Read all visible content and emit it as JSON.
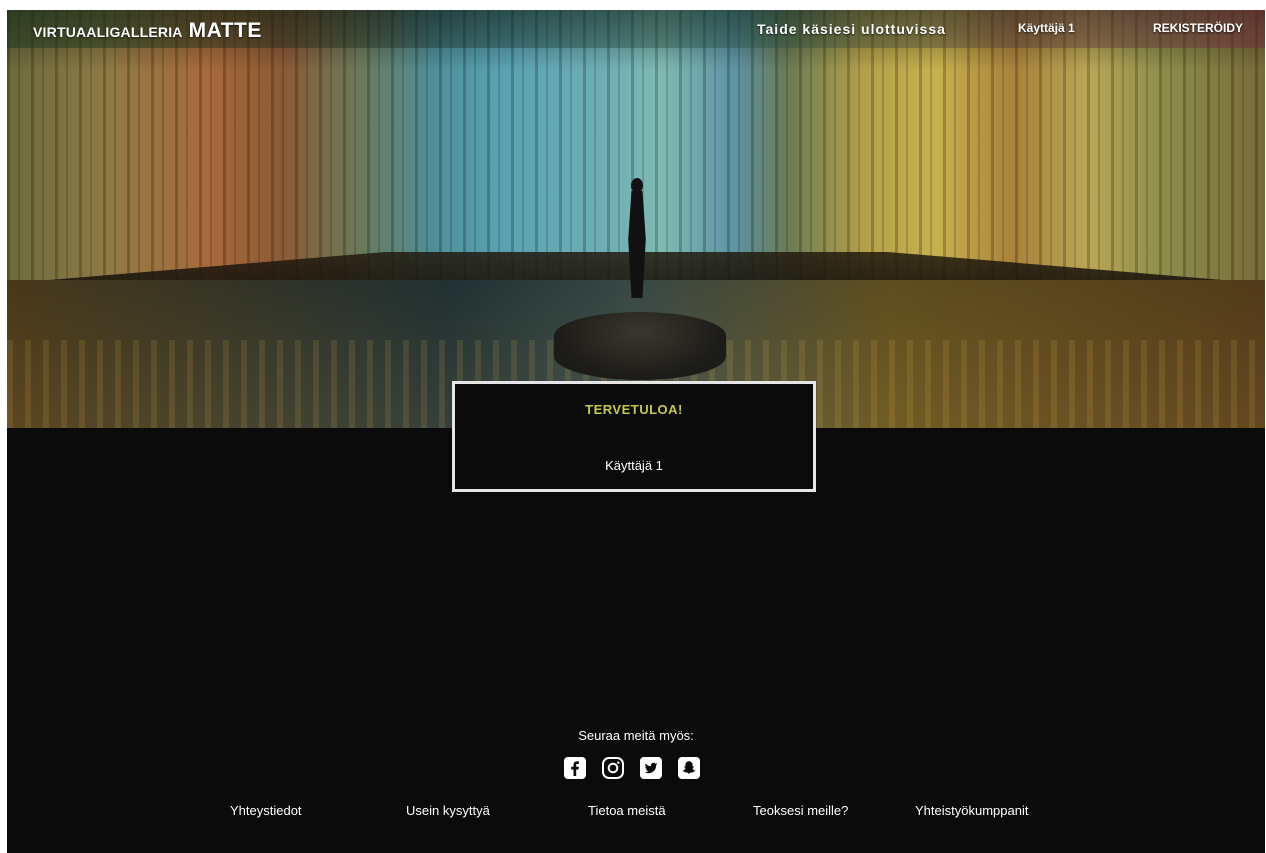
{
  "header": {
    "brand_prefix": "VIRTUAALIGALLERIA",
    "brand_name": "MATTE",
    "tagline": "Taide käsiesi ulottuvissa",
    "user_label": "Käyttäjä 1",
    "register_label": "REKISTERÖIDY"
  },
  "welcome": {
    "title": "TERVETULOA!",
    "user": "Käyttäjä 1"
  },
  "footer": {
    "follow_label": "Seuraa meitä myös:",
    "social_icons": [
      "facebook-icon",
      "instagram-icon",
      "twitter-icon",
      "snapchat-icon"
    ],
    "links": [
      "Yhteystiedot",
      "Usein kysyttyä",
      "Tietoa meistä",
      "Teoksesi meille?",
      "Yhteistyökumppanit"
    ]
  },
  "colors": {
    "background": "#0b0b0b",
    "welcome_title": "#c7c94a",
    "panel_border": "#e6e6e6",
    "text": "#ffffff"
  }
}
